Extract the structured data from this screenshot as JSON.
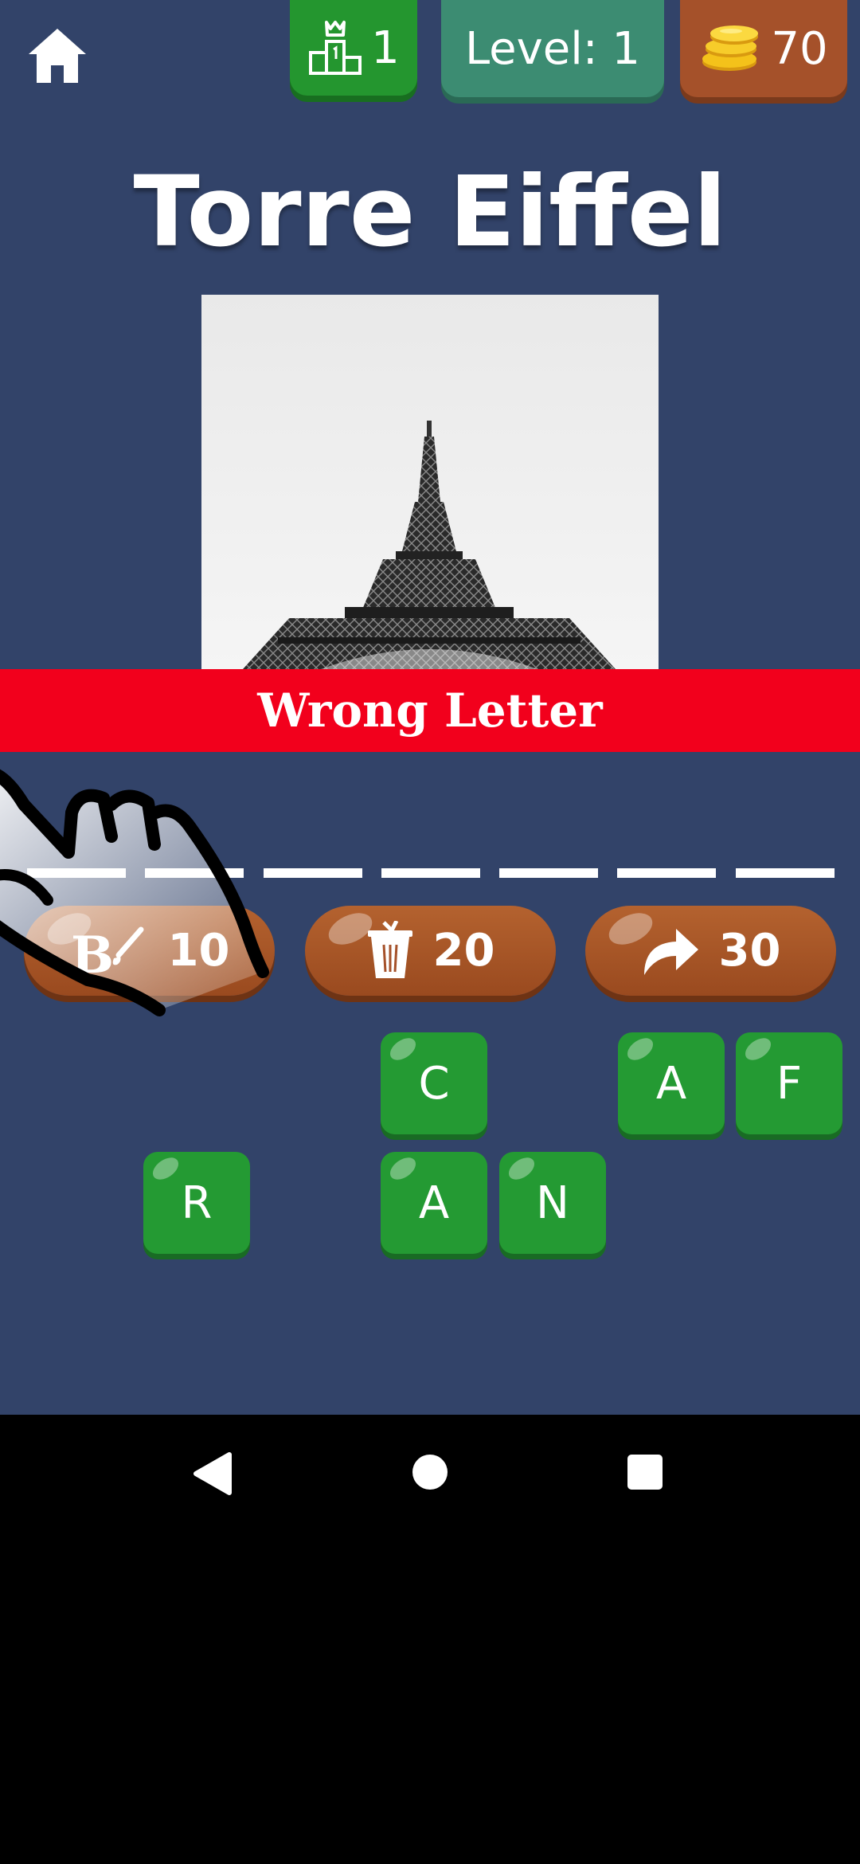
{
  "header": {
    "home_icon": "home-icon",
    "rank_icon": "podium-crown-icon",
    "rank_value": "1",
    "level_label": "Level: 1",
    "coins_icon": "gold-coins-icon",
    "coins_value": "70"
  },
  "puzzle": {
    "title": "Torre Eiffel",
    "image_subject": "eiffel-tower-photo"
  },
  "banner": {
    "message": "Wrong Letter",
    "color": "#f2001c"
  },
  "answer_slots": {
    "count": 7
  },
  "powerups": [
    {
      "icon": "brush-letter-icon",
      "cost": "10"
    },
    {
      "icon": "trash-bin-icon",
      "cost": "20"
    },
    {
      "icon": "skip-arrow-icon",
      "cost": "30"
    }
  ],
  "letters": {
    "row1": [
      "",
      "",
      "",
      "C",
      "",
      "A",
      "F"
    ],
    "row2": [
      "",
      "R",
      "",
      "A",
      "N",
      "",
      ""
    ]
  },
  "colors": {
    "background": "#324369",
    "tile_green": "#249a33",
    "powerup_brown": "#a5512a",
    "level_teal": "#3c8c72"
  },
  "system_nav": {
    "back_icon": "back-triangle-icon",
    "home_icon": "home-circle-icon",
    "recents_icon": "recents-square-icon"
  }
}
